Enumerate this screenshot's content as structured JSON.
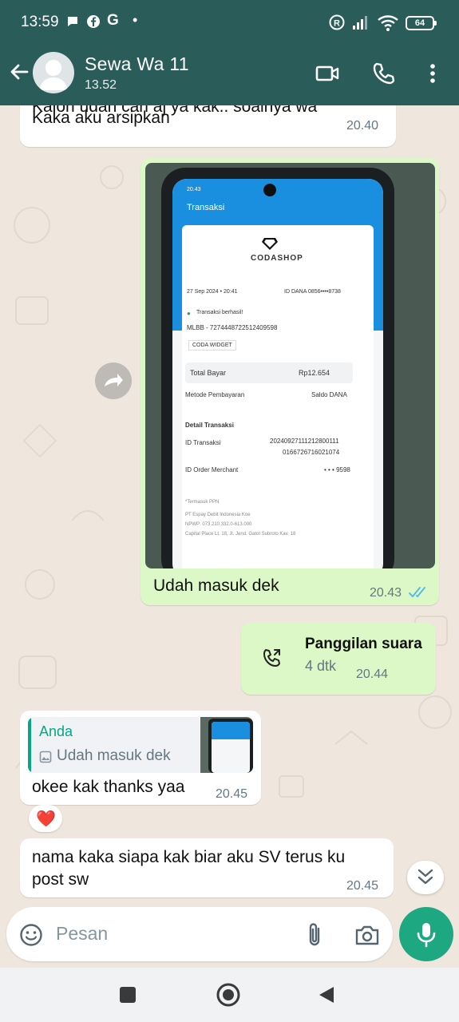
{
  "status_bar": {
    "time": "13:59",
    "battery": "64"
  },
  "header": {
    "contact_name": "Sewa Wa 11",
    "subtitle": "13.52"
  },
  "messages": {
    "m1": {
      "text_line1": "Kalon udah cari aj ya kak.. soalnya wa",
      "text_line2": "Kaka aku arsipkan",
      "time": "20.40"
    },
    "m2": {
      "caption": "Udah masuk dek",
      "time": "20.43",
      "receipt": {
        "screen_title": "Transaksi",
        "brand": "CODASHOP",
        "date": "27 Sep 2024 • 20:41",
        "dana_id": "ID DANA 0856••••8738",
        "status": "Transaksi berhasil!",
        "product": "MLBB - 7274448722512409598",
        "widget": "CODA WIDGET",
        "total_label": "Total Bayar",
        "total_value": "Rp12.654",
        "method_label": "Metode Pembayaran",
        "method_value": "Saldo DANA",
        "detail_label": "Detail Transaksi",
        "trx_label": "ID Transaksi",
        "trx_value_1": "20240927111212800111",
        "trx_value_2": "0166726716021074",
        "order_label": "ID Order Merchant",
        "order_value": "• • • 9598",
        "ppn": "*Termasuk PPN",
        "company": "PT Espay Debit Indonesia Koe",
        "npwp": "NPWP: 073.210.332.0-613.000",
        "address": "Capital Place Lt. 18, Jl. Jend. Gatot Subroto Kav. 18"
      }
    },
    "m3": {
      "title": "Panggilan suara",
      "duration": "4 dtk",
      "time": "20.44"
    },
    "m4": {
      "quote_author": "Anda",
      "quote_text": "Udah masuk dek",
      "text": "okee kak thanks yaa",
      "time": "20.45",
      "reaction": "❤️"
    },
    "m5": {
      "text_line1": "nama kaka siapa kak biar aku SV terus ku",
      "text_line2": "post sw",
      "time": "20.45"
    }
  },
  "input": {
    "placeholder": "Pesan"
  },
  "colors": {
    "header": "#2a5c5a",
    "outgoing": "#dbf8c6",
    "incoming": "#ffffff",
    "accent": "#1da882",
    "read_ticks": "#53bdeb"
  }
}
